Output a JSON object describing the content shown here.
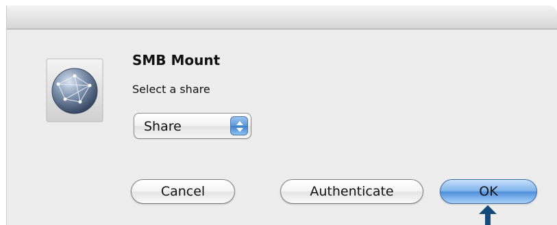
{
  "dialog": {
    "title": "SMB Mount",
    "subtitle": "Select a share",
    "icon": "network-globe-icon",
    "share_popup": {
      "selected": "Share"
    },
    "buttons": {
      "cancel": "Cancel",
      "authenticate": "Authenticate",
      "ok": "OK"
    },
    "pointer_icon": "up-arrow-indicator-icon",
    "colors": {
      "default_button": "#6aa7e6",
      "pointer": "#134a78"
    }
  }
}
